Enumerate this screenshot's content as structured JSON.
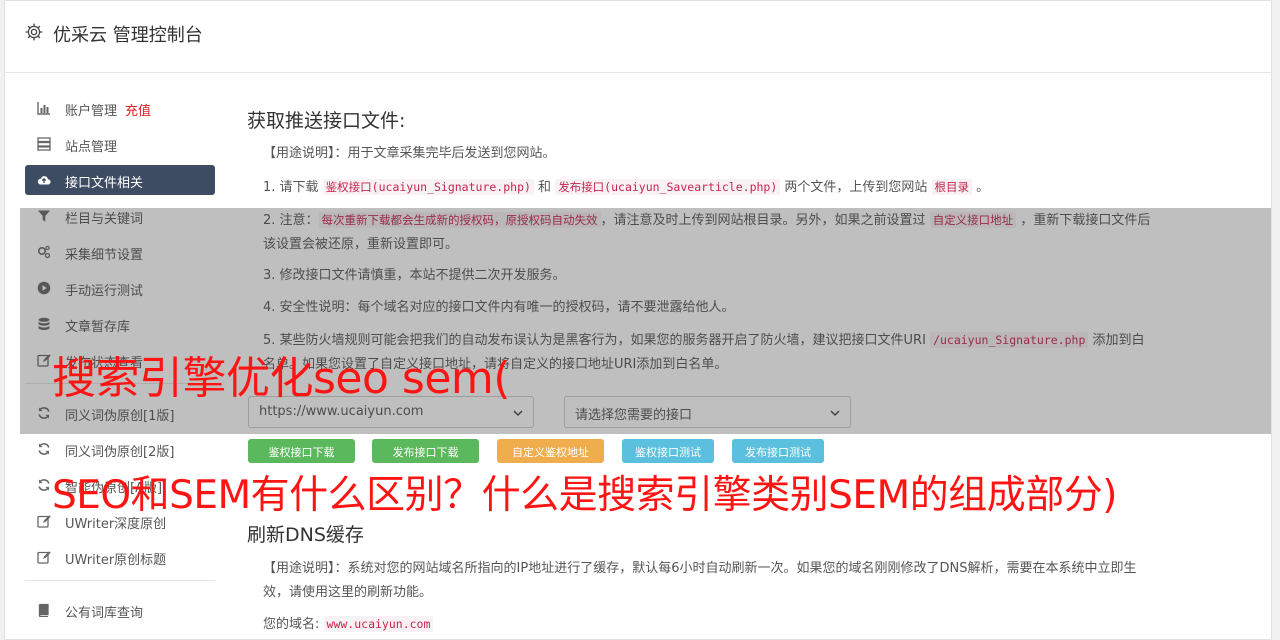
{
  "header": {
    "title": "优采云 管理控制台",
    "icon": "gear-icon"
  },
  "sidebar": {
    "items": [
      {
        "label": "账户管理",
        "badge": "充值",
        "icon": "bar-chart-icon"
      },
      {
        "label": "站点管理",
        "icon": "server-icon"
      },
      {
        "label": "接口文件相关",
        "icon": "cloud-upload-icon",
        "active": true
      },
      {
        "label": "栏目与关键词",
        "icon": "filter-icon"
      },
      {
        "label": "采集细节设置",
        "icon": "cogs-icon"
      },
      {
        "label": "手动运行测试",
        "icon": "play-circle-icon"
      },
      {
        "label": "文章暂存库",
        "icon": "database-icon"
      },
      {
        "label": "发布状态查看",
        "icon": "edit-icon"
      },
      {
        "label": "同义词伪原创[1版]",
        "icon": "refresh-icon"
      },
      {
        "label": "同义词伪原创[2版]",
        "icon": "refresh-icon"
      },
      {
        "label": "智能伪原创[A版]",
        "icon": "refresh-icon"
      },
      {
        "label": "UWriter深度原创",
        "icon": "edit-icon"
      },
      {
        "label": "UWriter原创标题",
        "icon": "edit-icon"
      },
      {
        "label": "公有词库查询",
        "icon": "book-icon"
      }
    ]
  },
  "main": {
    "section1": {
      "title": "获取推送接口文件:",
      "usage_label": "【用途说明】",
      "usage_text": "：用于文章采集完毕后发送到您网站。",
      "step1": {
        "a": "1. 请下载 ",
        "code1": "鉴权接口(ucaiyun_Signature.php)",
        "b": " 和 ",
        "code2": "发布接口(ucaiyun_Savearticle.php)",
        "c": " 两个文件，上传到您网站 ",
        "code3": "根目录",
        "d": " 。"
      },
      "step2": {
        "a": "2. 注意：",
        "code1": "每次重新下载都会生成新的授权码，原授权码自动失效",
        "b": "，请注意及时上传到网站根目录。另外，如果之前设置过 ",
        "code2": "自定义接口地址",
        "c": " ，重新下载接口文件后该设置会被还原，重新设置即可。"
      },
      "step3": "3. 修改接口文件请慎重，本站不提供二次开发服务。",
      "step4": "4. 安全性说明：每个域名对应的接口文件内有唯一的授权码，请不要泄露给他人。",
      "step5": {
        "a": "5. 某些防火墙规则可能会把我们的自动发布误认为是黑客行为，如果您的服务器开启了防火墙，建议把接口文件URI ",
        "code1": "/ucaiyun_Signature.php",
        "b": " 添加到白名单。如果您设置了自定义接口地址，请将自定义的接口地址URI添加到白名单。"
      },
      "site_select": "https://www.ucaiyun.com",
      "api_select": "请选择您需要的接口",
      "buttons": {
        "download_auth": "鉴权接口下载",
        "download_publish": "发布接口下载",
        "custom_auth": "自定义鉴权地址",
        "test_auth": "鉴权接口测试",
        "test_publish": "发布接口测试"
      }
    },
    "section2": {
      "title": "刷新DNS缓存",
      "usage_label": "【用途说明】",
      "usage_text": "：系统对您的网站域名所指向的IP地址进行了缓存，默认每6小时自动刷新一次。如果您的域名刚刚修改了DNS解析，需要在本系统中立即生效，请使用这里的刷新功能。",
      "domain_label": "您的域名:",
      "domain_value": "www.ucaiyun.com"
    }
  },
  "overlay_text": {
    "line1": "搜索引擎优化seo sem(",
    "line2": "SEO和SEM有什么区别？什么是搜索引擎类别SEM的组成部分)"
  },
  "colors": {
    "active_nav": "#3d4c63",
    "badge_red": "#e02020",
    "btn_green": "#5cb85c",
    "btn_orange": "#f0ad4e",
    "btn_blue": "#5bc0de",
    "overlay_red": "#ff1414"
  }
}
